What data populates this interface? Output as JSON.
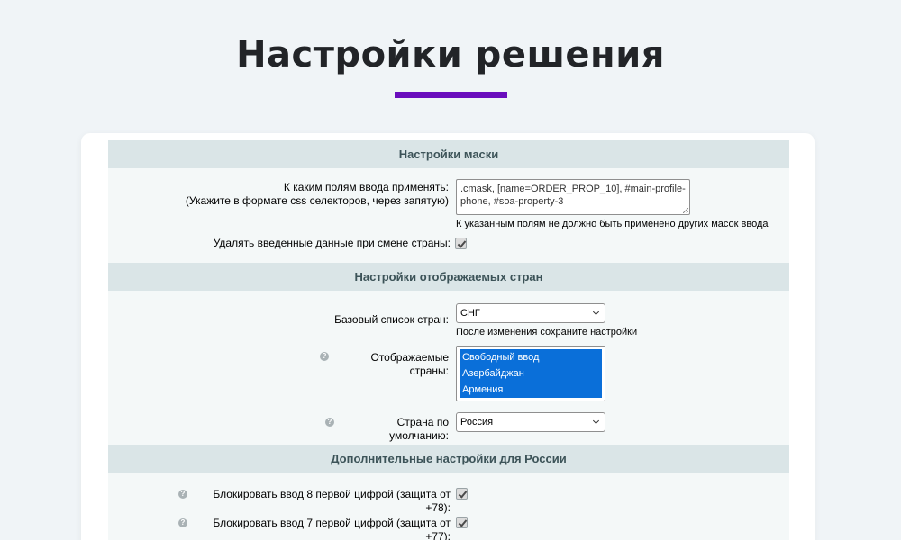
{
  "page": {
    "title": "Настройки решения"
  },
  "sections": {
    "mask": {
      "header": "Настройки маски",
      "fields_label_line1": "К каким полям ввода применять:",
      "fields_label_line2": "(Укажите в формате css селекторов, через запятую)",
      "fields_value": ".cmask, [name=ORDER_PROP_10], #main-profile-phone, #soa-property-3",
      "fields_note": "К указанным полям не должно быть применено других масок ввода",
      "clear_label": "Удалять введенные данные при смене страны:",
      "clear_checked": true
    },
    "countries": {
      "header": "Настройки отображаемых стран",
      "base_list_label": "Базовый список стран:",
      "base_list_value": "СНГ",
      "base_list_note": "После изменения сохраните настройки",
      "displayed_label": "Отображаемые страны:",
      "displayed_options": [
        "Свободный ввод",
        "Азербайджан",
        "Армения"
      ],
      "default_label": "Страна по умолчанию:",
      "default_value": "Россия"
    },
    "russia": {
      "header": "Дополнительные настройки для России",
      "block8_label": "Блокировать ввод 8 первой цифрой (защита от +78):",
      "block8_checked": true,
      "block7_label": "Блокировать ввод 7 первой цифрой (защита от +77):",
      "block7_checked": true
    }
  },
  "icons": {
    "help": "?"
  },
  "colors": {
    "accent": "#6a0dbd",
    "section_header_bg": "#dae5e7",
    "selected_option_bg": "#0a6fd9"
  }
}
